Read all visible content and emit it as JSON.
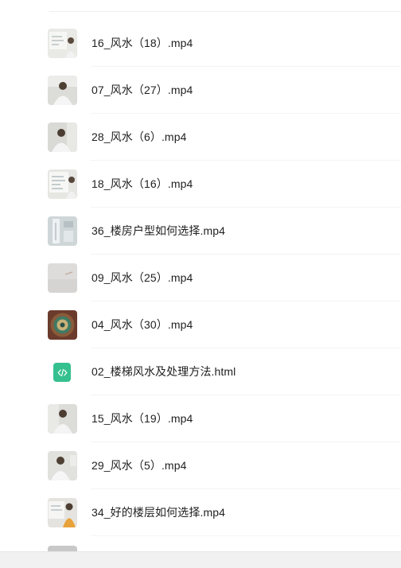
{
  "files": [
    {
      "name": "16_风水（18）.mp4",
      "thumb": "video-thumbnail-whiteboard"
    },
    {
      "name": "07_风水（27）.mp4",
      "thumb": "video-thumbnail-speaker"
    },
    {
      "name": "28_风水（6）.mp4",
      "thumb": "video-thumbnail-speaker"
    },
    {
      "name": "18_风水（16）.mp4",
      "thumb": "video-thumbnail-whiteboard"
    },
    {
      "name": "36_楼房户型如何选择.mp4",
      "thumb": "video-thumbnail-room"
    },
    {
      "name": "09_风水（25）.mp4",
      "thumb": "video-thumbnail-wall"
    },
    {
      "name": "04_风水（30）.mp4",
      "thumb": "video-thumbnail-compass"
    },
    {
      "name": "02_楼梯风水及处理方法.html",
      "thumb": "html-file-icon"
    },
    {
      "name": "15_风水（19）.mp4",
      "thumb": "video-thumbnail-speaker"
    },
    {
      "name": "29_风水（5）.mp4",
      "thumb": "video-thumbnail-speaker"
    },
    {
      "name": "34_好的楼层如何选择.mp4",
      "thumb": "video-thumbnail-speaker-orange"
    }
  ],
  "colors": {
    "html_icon": "#35c08f",
    "text": "#1f1f1f",
    "divider": "#f4f4f4"
  }
}
